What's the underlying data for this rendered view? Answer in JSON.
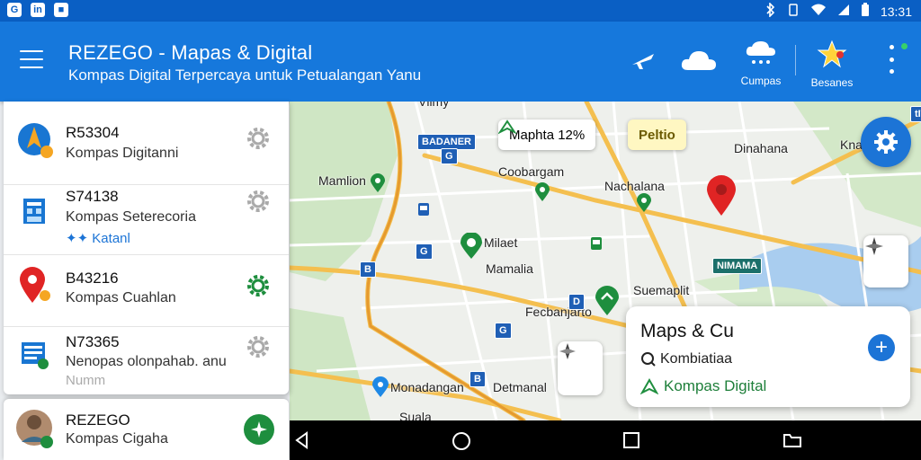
{
  "status_bar": {
    "left_icons": [
      "G",
      "in",
      "■"
    ],
    "time": "13:31"
  },
  "app_bar": {
    "title": "REZEGO - Mapas & Digital",
    "subtitle": "Kompas Digital Terpercaya untuk Petualangan Yanu",
    "icons": [
      {
        "name": "airplane-icon",
        "label": ""
      },
      {
        "name": "cloud-icon",
        "label": ""
      },
      {
        "name": "weather-icon",
        "label": "Cumpas"
      },
      {
        "name": "star-icon",
        "label": "Besanes"
      }
    ]
  },
  "panel": {
    "items": [
      {
        "title": "R53304",
        "subtitle": "Kompas Digitanni",
        "extra": "",
        "icon": "compass-app-icon",
        "gear_active": false
      },
      {
        "title": "S74138",
        "subtitle": "Kompas Seterecoria",
        "extra": "✦✦ Katanl",
        "icon": "building-icon",
        "gear_active": false
      },
      {
        "title": "B43216",
        "subtitle": "Kompas Cuahlan",
        "extra": "",
        "icon": "location-pin-icon",
        "gear_active": true
      },
      {
        "title": "N73365",
        "subtitle": "Nenopas olonpahab. anu",
        "extra": "Numm",
        "icon": "document-stack-icon",
        "gear_active": false
      }
    ],
    "bottom": {
      "title": "REZEGO",
      "subtitle": "Kompas Cigaha"
    }
  },
  "map": {
    "labels": [
      "Vlimy",
      "Mamlion",
      "Coobargam",
      "Nachalana",
      "Dinahana",
      "Kna",
      "Milaet",
      "Mamalia",
      "Suemaplit",
      "Fecbanjarto",
      "Monadangan",
      "Detmanal",
      "Suala"
    ],
    "signs": [
      "BADANER",
      "G",
      "G",
      "B",
      "G",
      "B",
      "D",
      "NIMAMA",
      "tIT"
    ],
    "chip_maps": "Maphta 12%",
    "chip_pelto": "Peltio",
    "info_card": {
      "title": "Maps & Cu",
      "line1": "Kombiatiaa",
      "line2": "Kompas Digital"
    }
  },
  "colors": {
    "app_bar": "#1678dc",
    "status_bar": "#0a5fc4",
    "accent_green": "#1e8e3e",
    "pin_red": "#e02424"
  }
}
